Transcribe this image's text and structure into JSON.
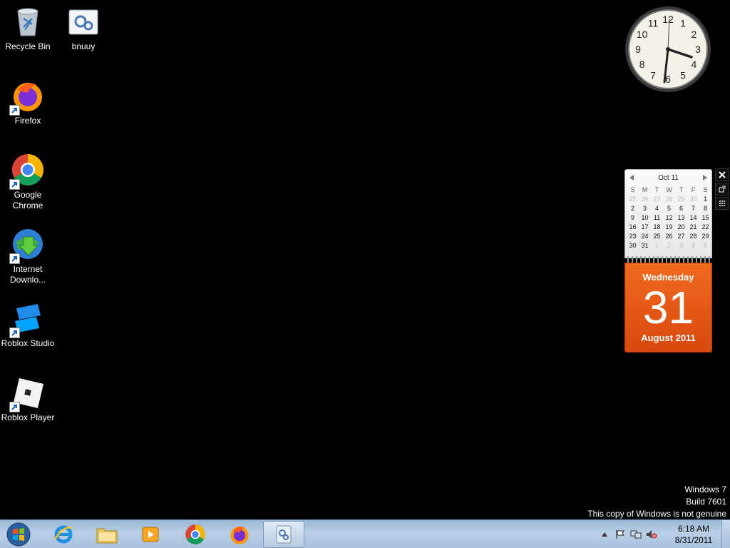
{
  "desktop": {
    "icons": [
      {
        "label": "Recycle Bin",
        "icon": "recycle-bin-icon"
      },
      {
        "label": "bnuuy",
        "icon": "settings-file-icon"
      },
      {
        "label": "Firefox",
        "icon": "firefox-icon"
      },
      {
        "label": "Google Chrome",
        "icon": "chrome-icon"
      },
      {
        "label": "Internet Downlo...",
        "icon": "internet-download-manager-icon"
      },
      {
        "label": "Roblox Studio",
        "icon": "roblox-studio-icon"
      },
      {
        "label": "Roblox Player",
        "icon": "roblox-player-icon"
      }
    ]
  },
  "calendar_gadget": {
    "month_title": "Oct 11",
    "weekdays": [
      "S",
      "M",
      "T",
      "W",
      "T",
      "F",
      "S"
    ],
    "days": [
      [
        "25",
        "26",
        "27",
        "28",
        "29",
        "30",
        "1"
      ],
      [
        "2",
        "3",
        "4",
        "5",
        "6",
        "7",
        "8"
      ],
      [
        "9",
        "10",
        "11",
        "12",
        "13",
        "14",
        "15"
      ],
      [
        "16",
        "17",
        "18",
        "19",
        "20",
        "21",
        "22"
      ],
      [
        "23",
        "24",
        "25",
        "26",
        "27",
        "28",
        "29"
      ],
      [
        "30",
        "31",
        "1",
        "2",
        "3",
        "4",
        "5"
      ]
    ],
    "weekday": "Wednesday",
    "day": "31",
    "month_year": "August 2011",
    "accent_color": "#e65a17"
  },
  "clock_gadget": {
    "numerals": [
      "12",
      "1",
      "2",
      "3",
      "4",
      "5",
      "6",
      "7",
      "8",
      "9",
      "10",
      "11"
    ]
  },
  "watermark": {
    "line1": "Windows 7",
    "line2": "Build 7601",
    "line3": "This copy of Windows is not genuine"
  },
  "taskbar": {
    "pinned": [
      {
        "name": "internet-explorer-icon"
      },
      {
        "name": "windows-explorer-icon"
      },
      {
        "name": "media-player-icon"
      },
      {
        "name": "chrome-icon"
      },
      {
        "name": "firefox-icon"
      },
      {
        "name": "settings-file-icon",
        "active": true
      }
    ],
    "time": "6:18 AM",
    "date": "8/31/2011"
  }
}
